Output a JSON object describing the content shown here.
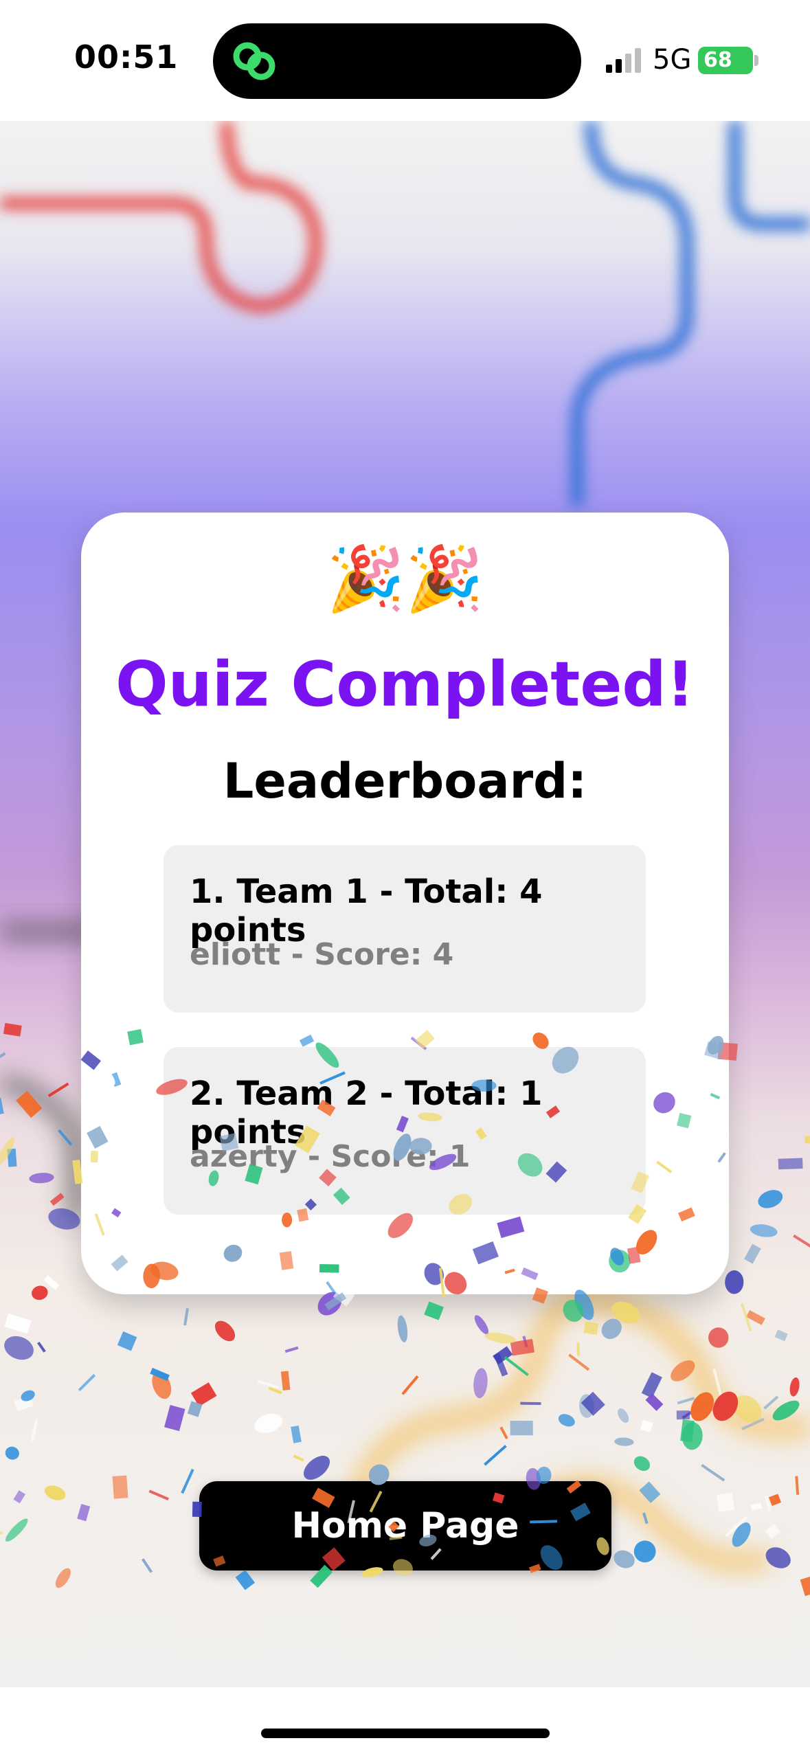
{
  "status_bar": {
    "time": "00:51",
    "network": "5G",
    "battery": "68",
    "battery_color": "#34c759",
    "island_app_icon": "link-chain-icon"
  },
  "card": {
    "emoji": "🎉🎉",
    "title": "Quiz Completed!",
    "subtitle": "Leaderboard:",
    "title_color": "#7b12f2",
    "entries": [
      {
        "team_line": "1. Team 1 - Total: 4 points",
        "player_line": "eliott - Score: 4"
      },
      {
        "team_line": "2. Team 2 - Total: 1 points",
        "player_line": "azerty - Score: 1"
      }
    ]
  },
  "home_button": {
    "label": "Home Page"
  },
  "background": {
    "line_colors": [
      "#e53935",
      "#2f6fd6",
      "#f4b63c",
      "#444444"
    ]
  }
}
